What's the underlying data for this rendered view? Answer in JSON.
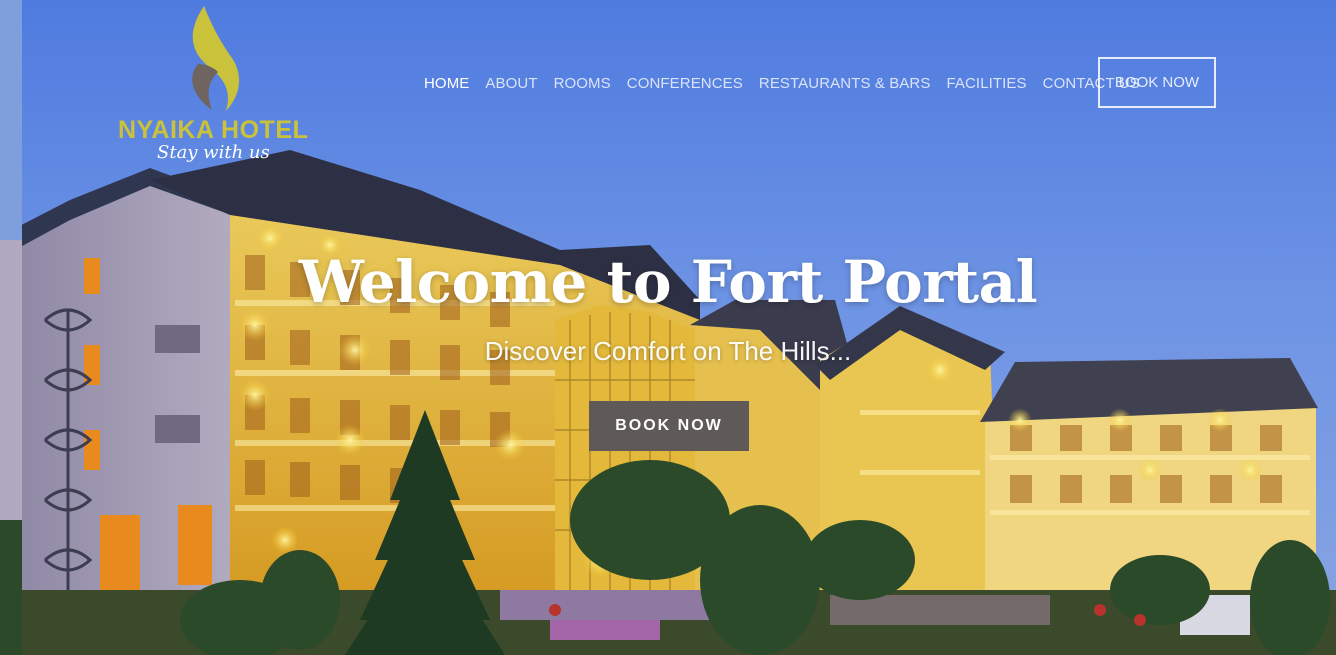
{
  "brand": {
    "name": "NYAIKA HOTEL",
    "tagline": "Stay with us",
    "accent_color": "#c9c23a",
    "flame_secondary_color": "#6f645f"
  },
  "nav": {
    "items": [
      {
        "label": "HOME",
        "active": true
      },
      {
        "label": "ABOUT",
        "active": false
      },
      {
        "label": "ROOMS",
        "active": false
      },
      {
        "label": "CONFERENCES",
        "active": false
      },
      {
        "label": "RESTAURANTS & BARS",
        "active": false
      },
      {
        "label": "FACILITIES",
        "active": false
      },
      {
        "label": "CONTACT US",
        "active": false
      }
    ],
    "book_label": "BOOK NOW"
  },
  "hero": {
    "title": "Welcome to Fort Portal",
    "subtitle": "Discover Comfort on The Hills...",
    "book_label": "BOOK NOW",
    "button_color": "#5f5a57"
  }
}
